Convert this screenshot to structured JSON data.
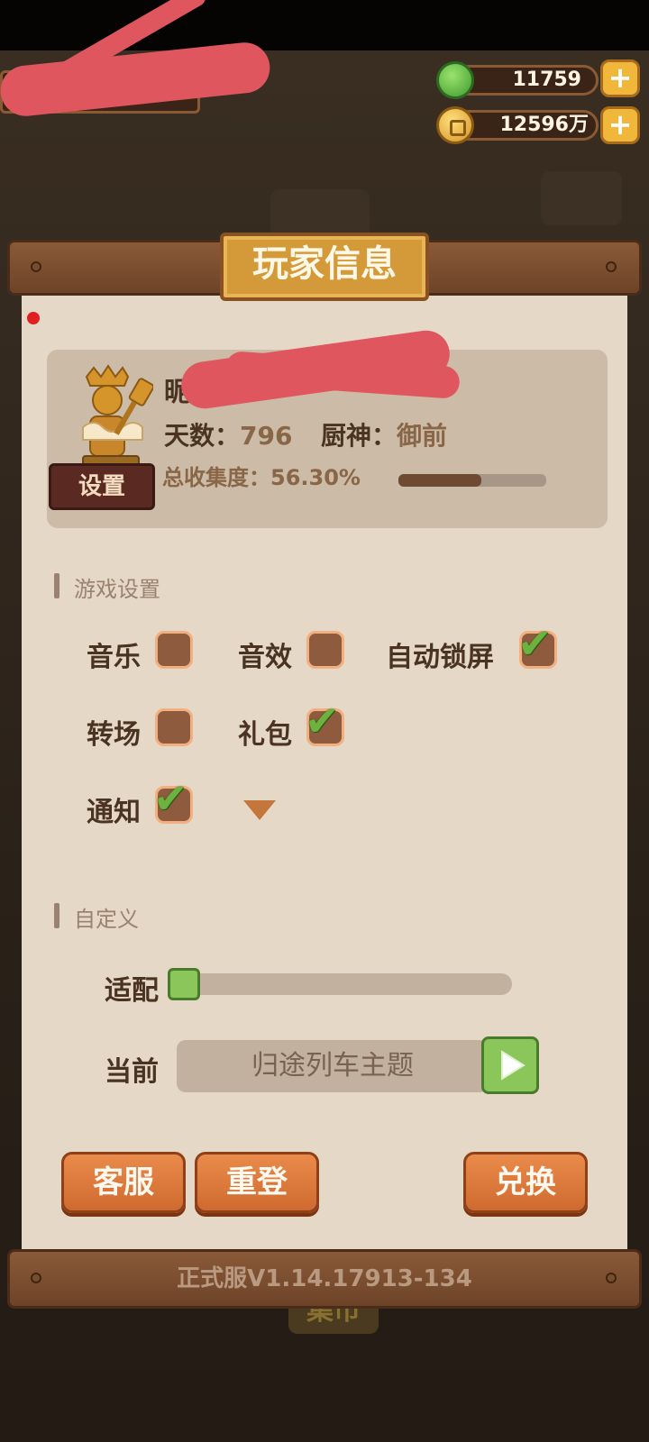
{
  "currency": {
    "gems": {
      "icon": "green-gem-icon",
      "value": "11759"
    },
    "coins": {
      "icon": "coin-icon",
      "value": "12596万"
    }
  },
  "panel": {
    "title": "玩家信息",
    "profile": {
      "name_visible": "昵",
      "settings_label": "设置",
      "days_label": "天数：",
      "days_value": "796",
      "chef_label": "厨神：",
      "chef_value": "御前",
      "collection_label": "总收集度：",
      "collection_value": "56.30%",
      "collection_fraction": 0.563
    },
    "game_settings": {
      "title": "游戏设置",
      "items": [
        {
          "label": "音乐",
          "checked": false
        },
        {
          "label": "音效",
          "checked": false
        },
        {
          "label": "自动锁屏",
          "checked": true
        },
        {
          "label": "转场",
          "checked": false
        },
        {
          "label": "礼包",
          "checked": true
        },
        {
          "label": "通知",
          "checked": true
        }
      ]
    },
    "custom": {
      "title": "自定义",
      "adapt_label": "适配",
      "adapt_level": 0,
      "current_label": "当前",
      "current_theme": "归途列车主题"
    },
    "buttons": {
      "service": "客服",
      "relogin": "重登",
      "redeem": "兑换"
    },
    "version": "正式服V1.14.17913-134"
  },
  "background": {
    "market_sign": "集市"
  },
  "colors": {
    "accent_orange": "#d06a30",
    "check_green": "#6cb23f",
    "paper": "#e5d8c6",
    "wood": "#6d4328"
  }
}
